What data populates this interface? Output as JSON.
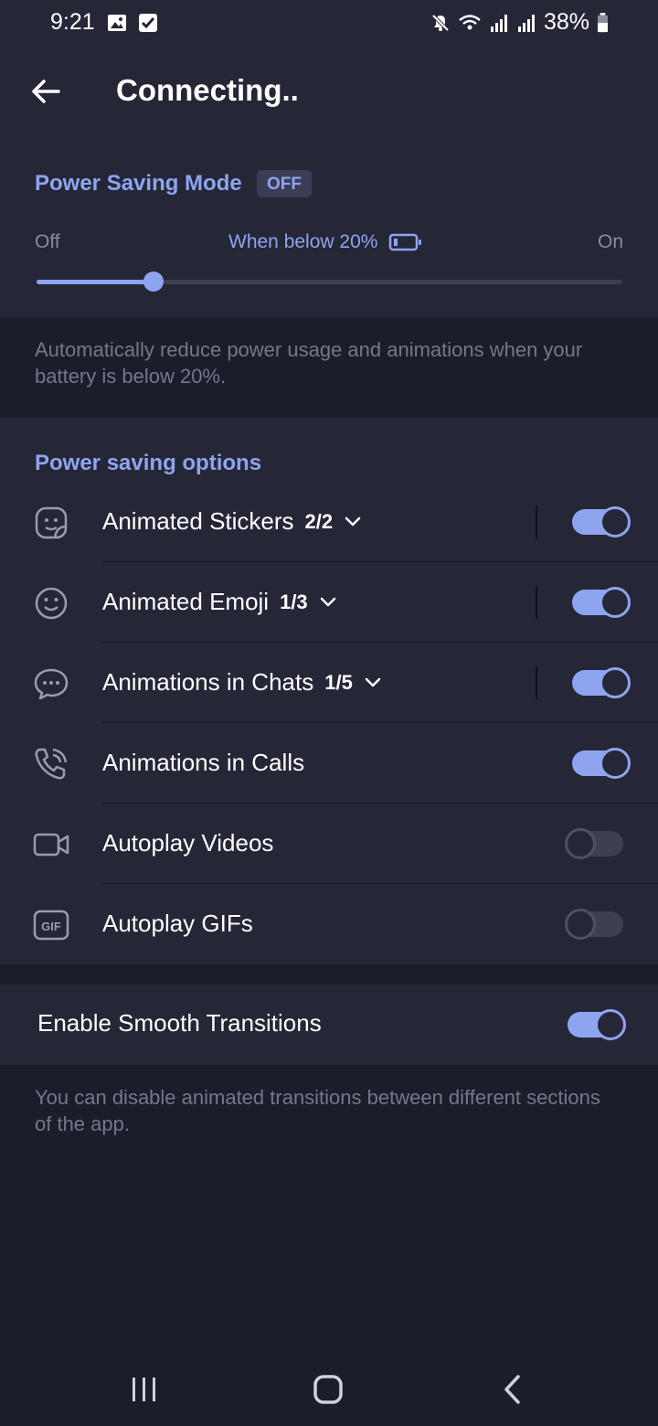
{
  "status_bar": {
    "time": "9:21",
    "battery_text": "38%",
    "icons_left": [
      "gallery-icon",
      "checkbox-icon"
    ],
    "icons_right": [
      "mute-icon",
      "wifi-icon",
      "signal-icon",
      "signal-icon",
      "battery-icon"
    ]
  },
  "header": {
    "title": "Connecting.."
  },
  "power_saving": {
    "title": "Power Saving Mode",
    "badge": "OFF",
    "slider": {
      "label_off": "Off",
      "label_mid": "When below 20%",
      "label_on": "On",
      "value_fraction": 0.2
    },
    "info": "Automatically reduce power usage and animations when your battery is below 20%."
  },
  "options": {
    "title": "Power saving options",
    "items": [
      {
        "label": "Animated Stickers",
        "count": "2/2",
        "icon": "sticker-icon",
        "enabled": true,
        "expandable": true
      },
      {
        "label": "Animated Emoji",
        "count": "1/3",
        "icon": "emoji-icon",
        "enabled": true,
        "expandable": true
      },
      {
        "label": "Animations in Chats",
        "count": "1/5",
        "icon": "chat-bubble-icon",
        "enabled": true,
        "expandable": true
      },
      {
        "label": "Animations in Calls",
        "count": "",
        "icon": "phone-call-icon",
        "enabled": true,
        "expandable": false
      },
      {
        "label": "Autoplay Videos",
        "count": "",
        "icon": "video-camera-icon",
        "enabled": false,
        "expandable": false
      },
      {
        "label": "Autoplay GIFs",
        "count": "",
        "icon": "gif-icon",
        "enabled": false,
        "expandable": false
      }
    ]
  },
  "smooth": {
    "label": "Enable Smooth Transitions",
    "enabled": true,
    "info": "You can disable animated transitions between different sections of the app."
  },
  "colors": {
    "accent": "#8ea4ef",
    "background": "#1c1d2a",
    "surface": "#252737"
  }
}
